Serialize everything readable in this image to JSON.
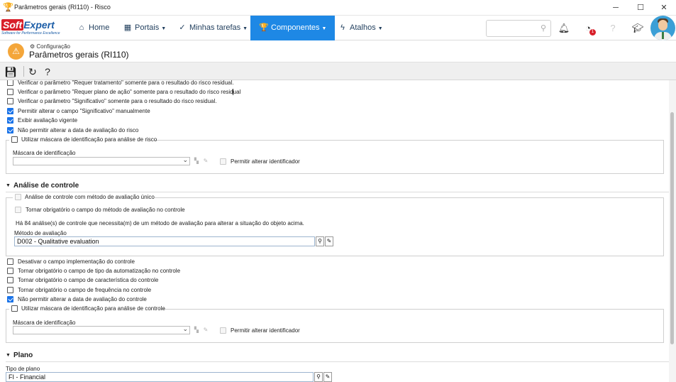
{
  "window": {
    "title": "Parâmetros gerais (RI110) - Risco",
    "minimize": "─",
    "maximize": "☐",
    "close": "✕"
  },
  "brand": {
    "logo_part1": "Soft",
    "logo_part2": "Expert",
    "tagline": "Software for Performance Excellence",
    "color_red": "#d81f2a",
    "color_blue": "#1e5fa8"
  },
  "nav": {
    "items": [
      {
        "label": "Home",
        "icon": "home-icon"
      },
      {
        "label": "Portais",
        "icon": "portal-icon"
      },
      {
        "label": "Minhas tarefas",
        "icon": "tasks-icon"
      },
      {
        "label": "Componentes",
        "icon": "trophy-icon"
      },
      {
        "label": "Atalhos",
        "icon": "bolt-icon"
      }
    ],
    "accent": "#1e88e5",
    "notification_count": "1"
  },
  "header": {
    "breadcrumb": "Configuração",
    "title": "Parâmetros gerais (RI110)"
  },
  "risk_options": [
    {
      "label": "Verificar o parâmetro \"Requer tratamento\" somente para o resultado do risco residual.",
      "checked": false
    },
    {
      "label": "Verificar o parâmetro \"Requer plano de ação\" somente para o resultado do risco residual",
      "checked": false
    },
    {
      "label": "Verificar o parâmetro \"Significativo\" somente para o resultado do risco residual.",
      "checked": false
    },
    {
      "label": "Permitir alterar o campo \"Significativo\" manualmente",
      "checked": true
    },
    {
      "label": "Exibir avaliação vigente",
      "checked": true
    },
    {
      "label": "Não permitir alterar a data de avaliação do risco",
      "checked": true
    }
  ],
  "risk_mask": {
    "legend": "Utilizar máscara de identificação para análise de risco",
    "mask_label": "Máscara de identificação",
    "allow_label": "Permitir alterar identificador"
  },
  "control_section": {
    "title": "Análise de controle",
    "single_method": "Análise de controle com método de avaliação único",
    "mandatory_method": "Tornar obrigatório o campo do método de avaliação no controle",
    "info": "Há 84 análise(s) de controle que necessita(m) de um método de avaliação para alterar a situação do objeto acima.",
    "method_label": "Método de avaliação",
    "method_value": "D002 - Qualitative evaluation",
    "options": [
      {
        "label": "Desativar o campo implementação do controle",
        "checked": false
      },
      {
        "label": "Tornar obrigatório o campo de tipo da automatização no controle",
        "checked": false
      },
      {
        "label": "Tornar obrigatório o campo de característica do controle",
        "checked": false
      },
      {
        "label": "Tornar obrigatório o campo de frequência no controle",
        "checked": false
      },
      {
        "label": "Não permitir alterar a data de avaliação do controle",
        "checked": true
      }
    ],
    "mask_legend": "Utilizar máscara de identificação para análise de controle",
    "mask_label": "Máscara de identificação",
    "allow_label": "Permitir alterar identificador"
  },
  "plan_section": {
    "title": "Plano",
    "type_label": "Tipo de plano",
    "type_value": "FI - Financial"
  }
}
